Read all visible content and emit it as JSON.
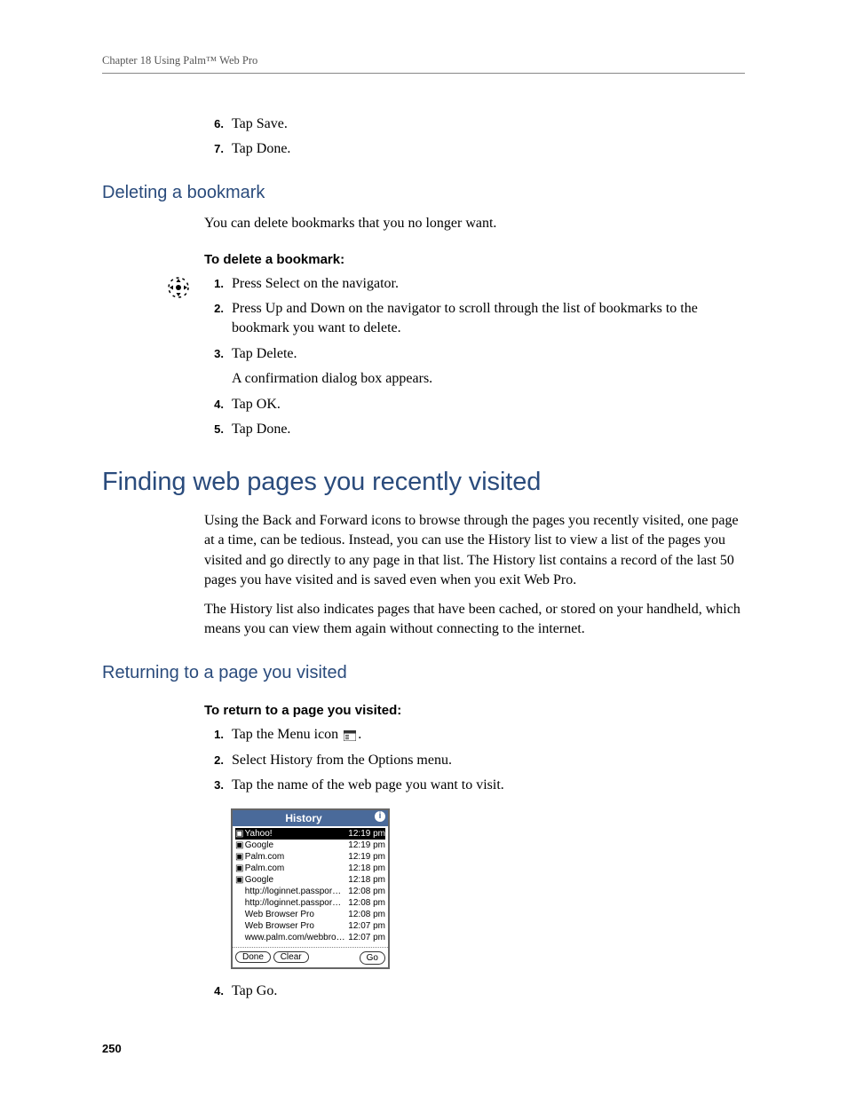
{
  "header": "Chapter 18   Using Palm™ Web Pro",
  "prior_steps": [
    {
      "n": "6.",
      "t": "Tap Save."
    },
    {
      "n": "7.",
      "t": "Tap Done."
    }
  ],
  "sec_delete": {
    "title": "Deleting a bookmark",
    "intro": "You can delete bookmarks that you no longer want.",
    "runhead": "To delete a bookmark:",
    "steps": [
      {
        "n": "1.",
        "t": "Press Select on the navigator."
      },
      {
        "n": "2.",
        "t": "Press Up and Down on the navigator to scroll through the list of bookmarks to the bookmark you want to delete."
      },
      {
        "n": "3.",
        "t": "Tap Delete.",
        "sub": "A confirmation dialog box appears."
      },
      {
        "n": "4.",
        "t": "Tap OK."
      },
      {
        "n": "5.",
        "t": "Tap Done."
      }
    ]
  },
  "sec_finding": {
    "title": "Finding web pages you recently visited",
    "para1": "Using the Back and Forward icons to browse through the pages you recently visited, one page at a time, can be tedious. Instead, you can use the History list to view a list of the pages you visited and go directly to any page in that list. The History list contains a record of the last 50 pages you have visited and is saved even when you exit Web Pro.",
    "para2": "The History list also indicates pages that have been cached, or stored on your handheld, which means you can view them again without connecting to the internet."
  },
  "sec_return": {
    "title": "Returning to a page you visited",
    "runhead": "To return to a page you visited:",
    "steps_a": [
      {
        "n": "1.",
        "t_pre": "Tap the Menu icon ",
        "t_post": "."
      }
    ],
    "steps_b": [
      {
        "n": "2.",
        "t": "Select History from the Options menu."
      },
      {
        "n": "3.",
        "t": "Tap the name of the web page you want to visit."
      }
    ],
    "steps_c": [
      {
        "n": "4.",
        "t": "Tap Go."
      }
    ]
  },
  "history_dialog": {
    "title": "History",
    "rows": [
      {
        "sel": true,
        "lock": true,
        "name": "Yahoo!",
        "time": "12:19 pm"
      },
      {
        "sel": false,
        "lock": true,
        "name": "Google",
        "time": "12:19 pm"
      },
      {
        "sel": false,
        "lock": true,
        "name": "Palm.com",
        "time": "12:19 pm"
      },
      {
        "sel": false,
        "lock": true,
        "name": "Palm.com",
        "time": "12:18 pm"
      },
      {
        "sel": false,
        "lock": true,
        "name": "Google",
        "time": "12:18 pm"
      },
      {
        "sel": false,
        "lock": false,
        "name": "http://loginnet.passpor…",
        "time": "12:08 pm"
      },
      {
        "sel": false,
        "lock": false,
        "name": "http://loginnet.passpor…",
        "time": "12:08 pm"
      },
      {
        "sel": false,
        "lock": false,
        "name": "Web Browser Pro",
        "time": "12:08 pm"
      },
      {
        "sel": false,
        "lock": false,
        "name": "Web Browser Pro",
        "time": "12:07 pm"
      },
      {
        "sel": false,
        "lock": false,
        "name": "www.palm.com/webbro…",
        "time": "12:07 pm"
      }
    ],
    "buttons": {
      "done": "Done",
      "clear": "Clear",
      "go": "Go"
    }
  },
  "page_number": "250"
}
